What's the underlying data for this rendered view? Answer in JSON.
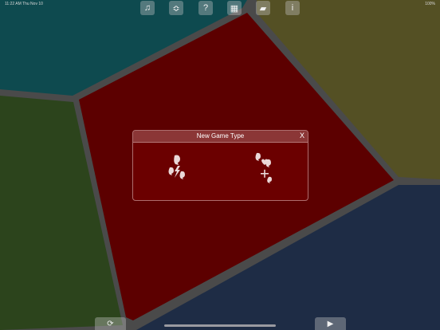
{
  "status_bar": {
    "time_date": "11:22 AM   Thu Nov 10",
    "battery": "100%"
  },
  "toolbar": {
    "music_icon": "♫",
    "cards_icon": "≎",
    "help_icon": "?",
    "pieces_icon": "▦",
    "folder_icon": "▰",
    "info_icon": "i"
  },
  "dialog": {
    "title": "New Game Type",
    "close_label": "X"
  },
  "bottom_bar": {
    "restart_icon": "⟳",
    "play_icon": "▶"
  },
  "colors": {
    "teal": "#0e4a4f",
    "olive": "#545024",
    "red": "#5c0000",
    "green": "#2c441c",
    "navy": "#1e2c45",
    "border": "#4a4a4a"
  }
}
